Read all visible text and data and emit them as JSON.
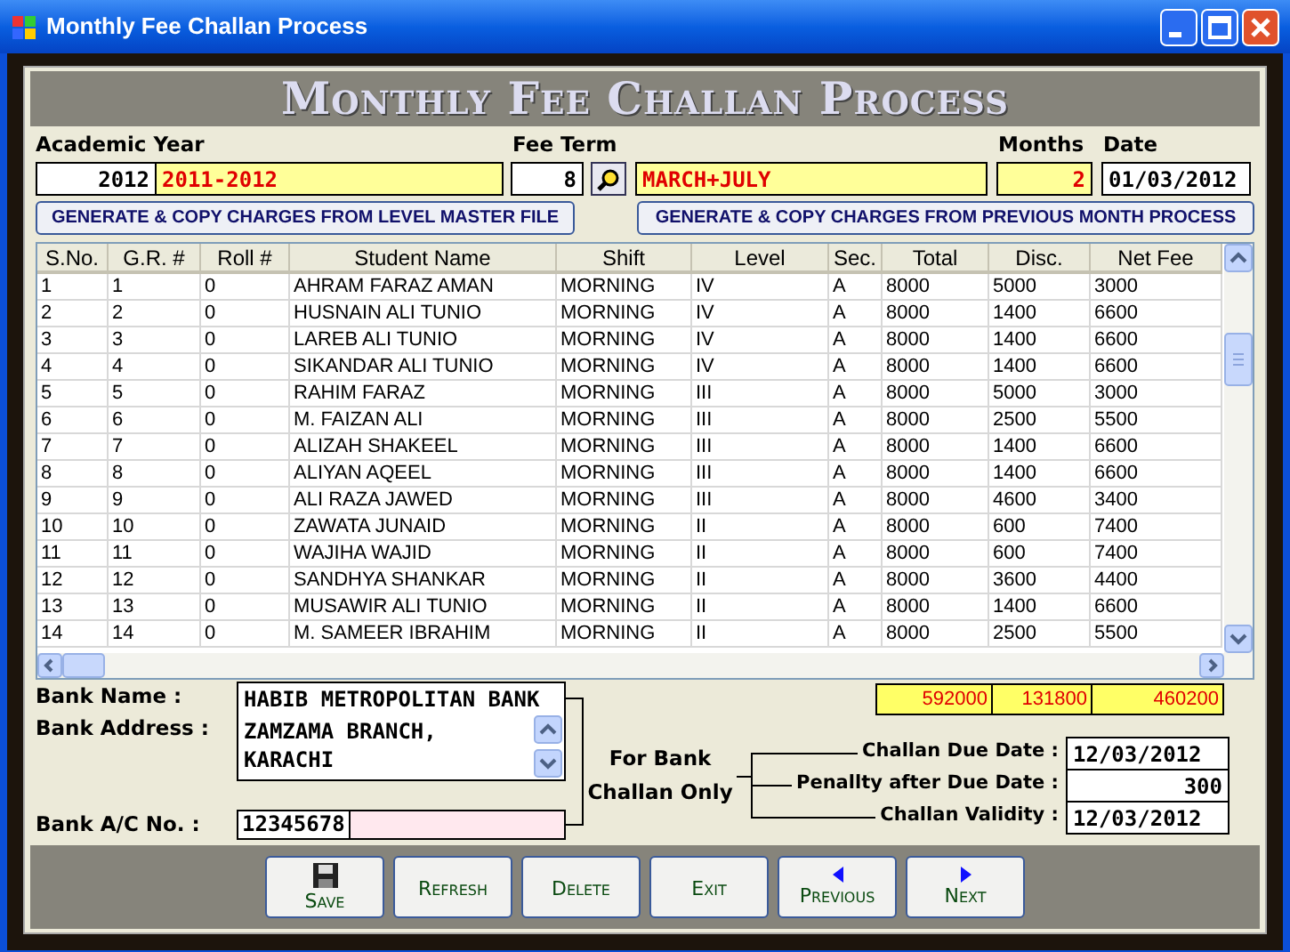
{
  "window": {
    "title": "Monthly Fee Challan Process"
  },
  "header": {
    "title": "Monthly Fee Challan Process"
  },
  "academic_year": {
    "label": "Academic Year",
    "year": "2012",
    "session": "2011-2012"
  },
  "fee_term": {
    "label": "Fee Term",
    "code": "8",
    "name": "MARCH+JULY"
  },
  "months": {
    "label": "Months",
    "value": "2"
  },
  "date": {
    "label": "Date",
    "value": "01/03/2012"
  },
  "generate_buttons": [
    "GENERATE & COPY CHARGES FROM LEVEL MASTER FILE",
    "GENERATE & COPY CHARGES FROM PREVIOUS MONTH PROCESS"
  ],
  "table": {
    "columns": [
      "S.No.",
      "G.R. #",
      "Roll #",
      "Student Name",
      "Shift",
      "Level",
      "Sec.",
      "Total",
      "Disc.",
      "Net Fee"
    ],
    "rows": [
      [
        "1",
        "1",
        "0",
        "AHRAM FARAZ AMAN",
        "MORNING",
        "IV",
        "A",
        "8000",
        "5000",
        "3000"
      ],
      [
        "2",
        "2",
        "0",
        "HUSNAIN ALI TUNIO",
        "MORNING",
        "IV",
        "A",
        "8000",
        "1400",
        "6600"
      ],
      [
        "3",
        "3",
        "0",
        "LAREB ALI TUNIO",
        "MORNING",
        "IV",
        "A",
        "8000",
        "1400",
        "6600"
      ],
      [
        "4",
        "4",
        "0",
        "SIKANDAR ALI TUNIO",
        "MORNING",
        "IV",
        "A",
        "8000",
        "1400",
        "6600"
      ],
      [
        "5",
        "5",
        "0",
        "RAHIM FARAZ",
        "MORNING",
        "III",
        "A",
        "8000",
        "5000",
        "3000"
      ],
      [
        "6",
        "6",
        "0",
        "M. FAIZAN ALI",
        "MORNING",
        "III",
        "A",
        "8000",
        "2500",
        "5500"
      ],
      [
        "7",
        "7",
        "0",
        "ALIZAH SHAKEEL",
        "MORNING",
        "III",
        "A",
        "8000",
        "1400",
        "6600"
      ],
      [
        "8",
        "8",
        "0",
        "ALIYAN AQEEL",
        "MORNING",
        "III",
        "A",
        "8000",
        "1400",
        "6600"
      ],
      [
        "9",
        "9",
        "0",
        "ALI RAZA JAWED",
        "MORNING",
        "III",
        "A",
        "8000",
        "4600",
        "3400"
      ],
      [
        "10",
        "10",
        "0",
        "ZAWATA JUNAID",
        "MORNING",
        "II",
        "A",
        "8000",
        "600",
        "7400"
      ],
      [
        "11",
        "11",
        "0",
        "WAJIHA WAJID",
        "MORNING",
        "II",
        "A",
        "8000",
        "600",
        "7400"
      ],
      [
        "12",
        "12",
        "0",
        "SANDHYA SHANKAR",
        "MORNING",
        "II",
        "A",
        "8000",
        "3600",
        "4400"
      ],
      [
        "13",
        "13",
        "0",
        "MUSAWIR ALI TUNIO",
        "MORNING",
        "II",
        "A",
        "8000",
        "1400",
        "6600"
      ],
      [
        "14",
        "14",
        "0",
        "M. SAMEER IBRAHIM",
        "MORNING",
        "II",
        "A",
        "8000",
        "2500",
        "5500"
      ]
    ]
  },
  "totals": [
    "592000",
    "131800",
    "460200"
  ],
  "bank": {
    "name_label": "Bank Name :",
    "name": "HABIB METROPOLITAN BANK",
    "address_label": "Bank Address :",
    "address": "ZAMZAMA BRANCH, KARACHI",
    "account_label": "Bank A/C No. :",
    "account": "12345678"
  },
  "bank_note": "For Bank Challan Only",
  "challan_fields": [
    {
      "label": "Challan Due Date :",
      "value": "12/03/2012",
      "kind": "date"
    },
    {
      "label": "Penallty after Due Date :",
      "value": "300",
      "kind": "amount"
    },
    {
      "label": "Challan Validity :",
      "value": "12/03/2012",
      "kind": "date"
    }
  ],
  "buttons": [
    {
      "label": "Save",
      "kind": "save"
    },
    {
      "label": "Refresh",
      "kind": "plain"
    },
    {
      "label": "Delete",
      "kind": "plain"
    },
    {
      "label": "Exit",
      "kind": "plain"
    },
    {
      "label": "Previous",
      "kind": "previous"
    },
    {
      "label": "Next",
      "kind": "next"
    }
  ]
}
